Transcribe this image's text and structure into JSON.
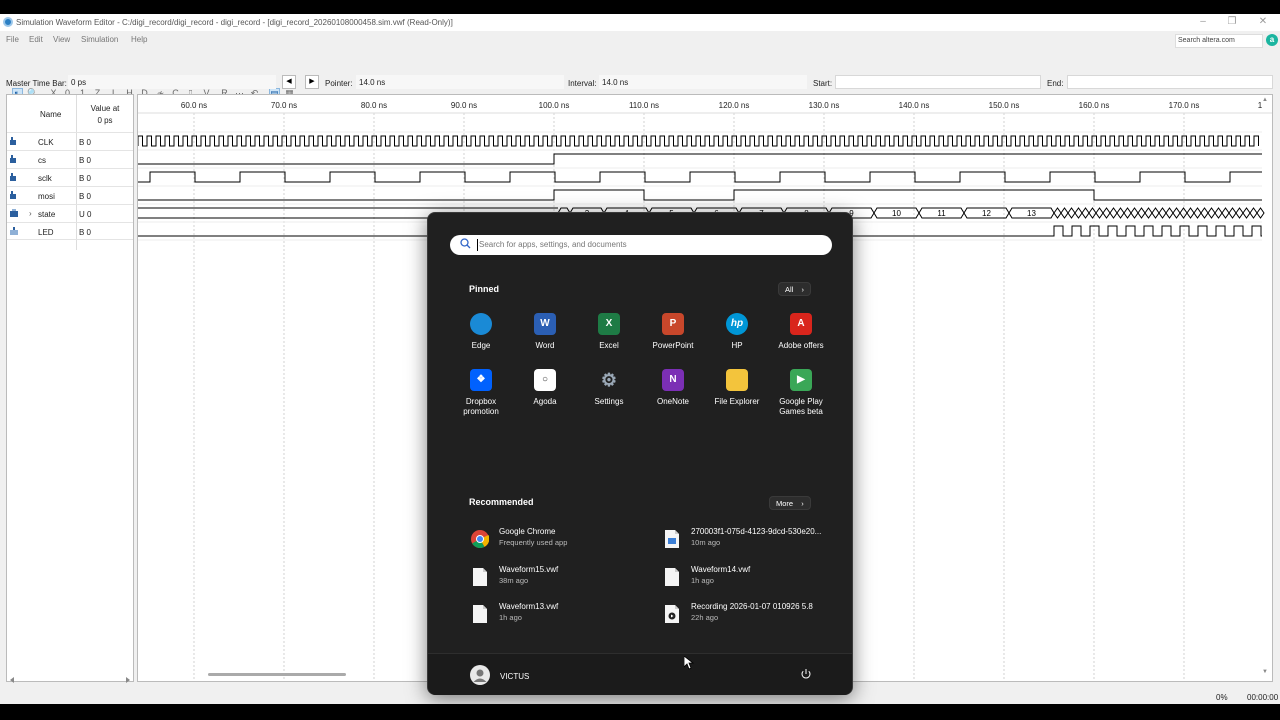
{
  "window": {
    "title": "Simulation Waveform Editor - C:/digi_record/digi_record - digi_record - [digi_record_20260108000458.sim.vwf (Read-Only)]",
    "controls": [
      "–",
      "❐",
      "✕"
    ]
  },
  "menu": [
    "File",
    "Edit",
    "View",
    "Simulation",
    "Help"
  ],
  "search_altera": {
    "placeholder": "Search altera.com"
  },
  "timebar": {
    "master_label": "Master Time Bar:",
    "master_value": "0 ps",
    "pointer_label": "Pointer:",
    "pointer_value": "14.0 ns",
    "interval_label": "Interval:",
    "interval_value": "14.0 ns",
    "start_label": "Start:",
    "start_value": "",
    "end_label": "End:",
    "end_value": ""
  },
  "columns": {
    "name": "Name",
    "value_line1": "Value at",
    "value_line2": "0 ps"
  },
  "signals": [
    {
      "name": "CLK",
      "value": "B 0",
      "type": "input"
    },
    {
      "name": "cs",
      "value": "B 0",
      "type": "input"
    },
    {
      "name": "sclk",
      "value": "B 0",
      "type": "input"
    },
    {
      "name": "mosi",
      "value": "B 0",
      "type": "input"
    },
    {
      "name": "state",
      "value": "U 0",
      "type": "bus",
      "expandable": true
    },
    {
      "name": "LED",
      "value": "B 0",
      "type": "output"
    }
  ],
  "time_ticks": [
    "60.0 ns",
    "70.0 ns",
    "80.0 ns",
    "90.0 ns",
    "100.0 ns",
    "110.0 ns",
    "120.0 ns",
    "130.0 ns",
    "140.0 ns",
    "150.0 ns",
    "160.0 ns",
    "170.0 ns",
    "1"
  ],
  "state_visible_values": [
    "2",
    "4",
    "5",
    "6",
    "7",
    "8",
    "9",
    "10",
    "11",
    "12",
    "13"
  ],
  "status": {
    "percent": "0%",
    "time": "00:00:00"
  },
  "start_menu": {
    "search_placeholder": "Search for apps, settings, and documents",
    "pinned_title": "Pinned",
    "all_button": "All",
    "pinned": [
      {
        "label": "Edge",
        "icon": "edge-icon",
        "color": "#1a8ad6"
      },
      {
        "label": "Word",
        "icon": "word-icon",
        "color": "#2b5fb4"
      },
      {
        "label": "Excel",
        "icon": "excel-icon",
        "color": "#1e7b45"
      },
      {
        "label": "PowerPoint",
        "icon": "powerpoint-icon",
        "color": "#c8472b"
      },
      {
        "label": "HP",
        "icon": "hp-icon",
        "color": "#0096d6"
      },
      {
        "label": "Adobe offers",
        "icon": "adobe-icon",
        "color": "#d9251c"
      },
      {
        "label": "Dropbox promotion",
        "icon": "dropbox-icon",
        "color": "#0061fe"
      },
      {
        "label": "Agoda",
        "icon": "agoda-icon",
        "color": "#ffffff"
      },
      {
        "label": "Settings",
        "icon": "settings-icon",
        "color": "#7a8a9a"
      },
      {
        "label": "OneNote",
        "icon": "onenote-icon",
        "color": "#7b2fb5"
      },
      {
        "label": "File Explorer",
        "icon": "folder-icon",
        "color": "#f3c43c"
      },
      {
        "label": "Google Play Games beta",
        "icon": "play-games-icon",
        "color": "#3aa757"
      }
    ],
    "pinned_glyphs": [
      "",
      "W",
      "X",
      "P",
      "hp",
      "A",
      "❖",
      "○",
      "⚙",
      "N",
      "",
      "▶"
    ],
    "recommended_title": "Recommended",
    "more_button": "More",
    "recommended": [
      {
        "title": "Google Chrome",
        "sub": "Frequently used app",
        "icon": "chrome-icon"
      },
      {
        "title": "270003f1-075d-4123-9dcd-530e20...",
        "sub": "10m ago",
        "icon": "image-file-icon"
      },
      {
        "title": "Waveform15.vwf",
        "sub": "38m ago",
        "icon": "file-icon"
      },
      {
        "title": "Waveform14.vwf",
        "sub": "1h ago",
        "icon": "file-icon"
      },
      {
        "title": "Waveform13.vwf",
        "sub": "1h ago",
        "icon": "file-icon"
      },
      {
        "title": "Recording 2026-01-07 010926 5.8",
        "sub": "22h ago",
        "icon": "video-file-icon"
      }
    ],
    "user": "VICTUS"
  }
}
